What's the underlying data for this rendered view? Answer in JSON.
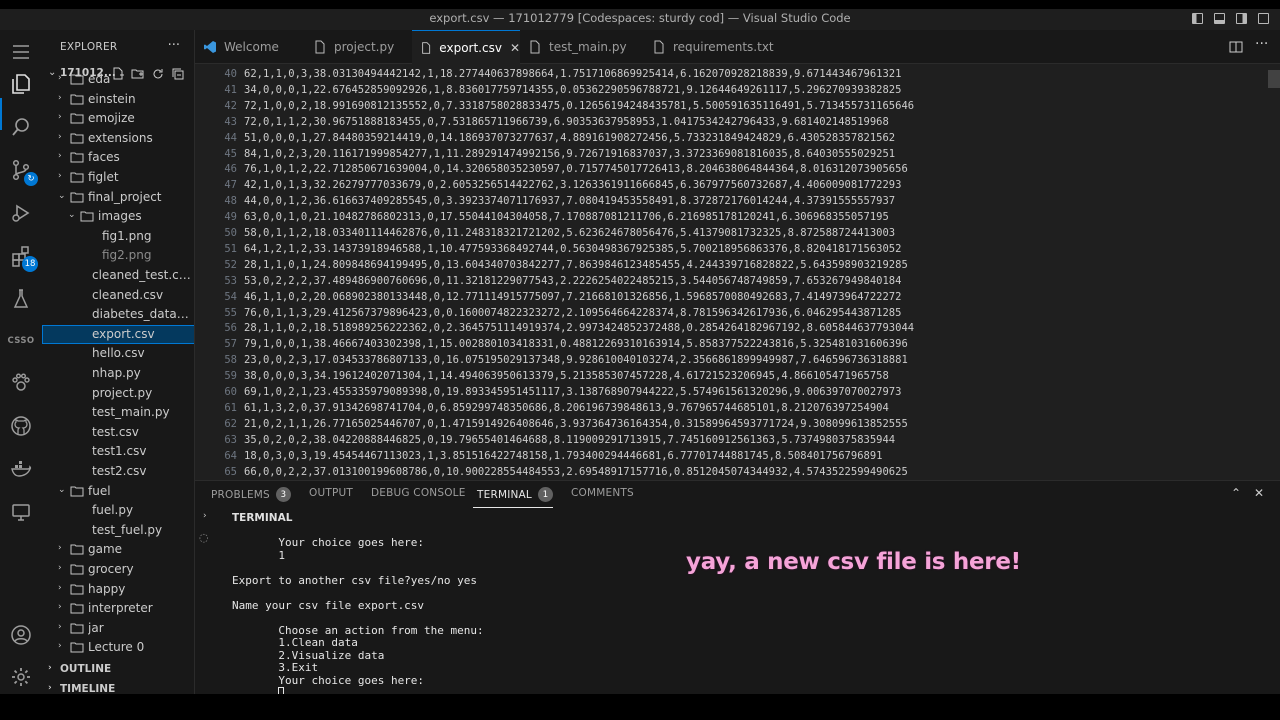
{
  "window": {
    "title": "export.csv — 17101277​9 [Codespaces: sturdy cod] — Visual Studio Code"
  },
  "activity_bar": {
    "extensions_badge": "18",
    "csso_label": "CSSO"
  },
  "sidebar": {
    "header": "EXPLORER",
    "more": "···",
    "root": "171012...",
    "items": [
      {
        "label": "eda",
        "type": "folder",
        "depth": 1,
        "expanded": false
      },
      {
        "label": "einstein",
        "type": "folder",
        "depth": 1,
        "expanded": false
      },
      {
        "label": "emojize",
        "type": "folder",
        "depth": 1,
        "expanded": false
      },
      {
        "label": "extensions",
        "type": "folder",
        "depth": 1,
        "expanded": false
      },
      {
        "label": "faces",
        "type": "folder",
        "depth": 1,
        "expanded": false
      },
      {
        "label": "figlet",
        "type": "folder",
        "depth": 1,
        "expanded": false
      },
      {
        "label": "final_project",
        "type": "folder",
        "depth": 1,
        "expanded": true
      },
      {
        "label": "images",
        "type": "folder",
        "depth": 2,
        "expanded": true
      },
      {
        "label": "fig1.png",
        "type": "file",
        "depth": 3
      },
      {
        "label": "fig2.png",
        "type": "file",
        "depth": 3,
        "dim": true
      },
      {
        "label": "cleaned_test.csv",
        "type": "file",
        "depth": 2
      },
      {
        "label": "cleaned.csv",
        "type": "file",
        "depth": 2
      },
      {
        "label": "diabetes_data....",
        "type": "file",
        "depth": 2
      },
      {
        "label": "export.csv",
        "type": "file",
        "depth": 2,
        "selected": true
      },
      {
        "label": "hello.csv",
        "type": "file",
        "depth": 2
      },
      {
        "label": "nhap.py",
        "type": "file",
        "depth": 2
      },
      {
        "label": "project.py",
        "type": "file",
        "depth": 2
      },
      {
        "label": "test_main.py",
        "type": "file",
        "depth": 2
      },
      {
        "label": "test.csv",
        "type": "file",
        "depth": 2
      },
      {
        "label": "test1.csv",
        "type": "file",
        "depth": 2
      },
      {
        "label": "test2.csv",
        "type": "file",
        "depth": 2
      },
      {
        "label": "fuel",
        "type": "folder",
        "depth": 1,
        "expanded": true
      },
      {
        "label": "fuel.py",
        "type": "file",
        "depth": 2
      },
      {
        "label": "test_fuel.py",
        "type": "file",
        "depth": 2
      },
      {
        "label": "game",
        "type": "folder",
        "depth": 1,
        "expanded": false
      },
      {
        "label": "grocery",
        "type": "folder",
        "depth": 1,
        "expanded": false
      },
      {
        "label": "happy",
        "type": "folder",
        "depth": 1,
        "expanded": false
      },
      {
        "label": "interpreter",
        "type": "folder",
        "depth": 1,
        "expanded": false
      },
      {
        "label": "jar",
        "type": "folder",
        "depth": 1,
        "expanded": false
      },
      {
        "label": "Lecture 0",
        "type": "folder",
        "depth": 1,
        "expanded": false
      }
    ],
    "outline": "OUTLINE",
    "timeline": "TIMELINE"
  },
  "tabs": [
    {
      "label": "Welcome",
      "icon": "vscode-icon"
    },
    {
      "label": "project.py",
      "icon": "file-icon"
    },
    {
      "label": "export.csv",
      "icon": "file-icon",
      "active": true
    },
    {
      "label": "test_main.py",
      "icon": "file-icon"
    },
    {
      "label": "requirements.txt",
      "icon": "file-icon"
    }
  ],
  "editor": {
    "lines": [
      {
        "n": "40",
        "t": "62,1,1,0,3,38.03130494442142,1,18.277440637898664,1.7517106869925414,6.162070928218839,9.671443467961321"
      },
      {
        "n": "41",
        "t": "34,0,0,0,1,22.676452859092926,1,8.836017759714355,0.05362290596788721,9.12644649261117,5.296270939382825"
      },
      {
        "n": "42",
        "t": "72,1,0,0,2,18.991690812135552,0,7.3318758028833475,0.12656194248435781,5.500591635116491,5.713455731165646"
      },
      {
        "n": "43",
        "t": "72,0,1,1,2,30.96751888183455,0,7.531865711966739,6.90353637958953,1.0417534242796433,9.681402148519968"
      },
      {
        "n": "44",
        "t": "51,0,0,0,1,27.84480359214419,0,14.186937073277637,4.889161908272456,5.733231849424829,6.430528357821562"
      },
      {
        "n": "45",
        "t": "84,1,0,2,3,20.116171999854277,1,11.289291474992156,9.72671916837037,3.3723369081816035,8.64030555029251"
      },
      {
        "n": "46",
        "t": "76,1,0,1,2,22.712850671639004,0,14.320658035230597,0.7157745017726413,8.204638064844364,8.016312073905656"
      },
      {
        "n": "47",
        "t": "42,1,0,1,3,32.26279777033679,0,2.6053256514422762,3.1263361911666845,6.367977560732687,4.406009081772293"
      },
      {
        "n": "48",
        "t": "44,0,0,1,2,36.616637409285545,0,3.3923374071176937,7.080419453558491,8.372872176014244,4.37391555557937"
      },
      {
        "n": "49",
        "t": "63,0,0,1,0,21.10482786802313,0,17.55044104304058,7.170887081211706,6.216985178120241,6.306968355057195"
      },
      {
        "n": "50",
        "t": "58,0,1,1,2,18.033401114462876,0,11.248318321721202,5.623624678056476,5.41379081732325,8.872588724413003"
      },
      {
        "n": "51",
        "t": "64,1,2,1,2,33.14373918946588,1,10.477593368492744,0.5630498367925385,5.700218956863376,8.820418171563052"
      },
      {
        "n": "52",
        "t": "28,1,1,0,1,24.809848694199495,0,13.604340703842277,7.8639846123485455,4.244339716828822,5.643598903219285"
      },
      {
        "n": "53",
        "t": "53,0,2,2,2,37.489486900760696,0,11.32181229077543,2.2226254022485215,3.544056748749859,7.653267949840184"
      },
      {
        "n": "54",
        "t": "46,1,1,0,2,20.068902380133448,0,12.771114915775097,7.21668101326856,1.5968570080492683,7.414973964722272"
      },
      {
        "n": "55",
        "t": "76,0,1,1,3,29.412567379896423,0,0.1600074822323272,2.109564664228374,8.781596342617936,6.046295443871285"
      },
      {
        "n": "56",
        "t": "28,1,1,0,2,18.518989256222362,0,2.3645751114919374,2.9973424852372488,0.2854264182967192,8.605844637793044"
      },
      {
        "n": "57",
        "t": "79,1,0,0,1,38.46667403302398,1,15.002880103418331,0.48812269310163914,5.858377522243816,5.325481031606396"
      },
      {
        "n": "58",
        "t": "23,0,0,2,3,17.034533786807133,0,16.075195029137348,9.928610040103274,2.3566861899949987,7.646596736318881"
      },
      {
        "n": "59",
        "t": "38,0,0,0,3,34.19612402071304,1,14.494063950613379,5.213585307457228,4.61721523206945,4.866105471965758"
      },
      {
        "n": "60",
        "t": "69,1,0,2,1,23.455335979089398,0,19.893345951451117,3.138768907944222,5.574961561320296,9.006397070027973"
      },
      {
        "n": "61",
        "t": "61,1,3,2,0,37.91342698741704,0,6.859299748350686,8.206196739848613,9.767965744685101,8.212076397254904"
      },
      {
        "n": "62",
        "t": "21,0,2,1,1,26.77165025446707,0,1.4715914926408646,3.937364736164354,0.31589964593771724,9.308099613852555"
      },
      {
        "n": "63",
        "t": "35,0,2,0,2,38.04220888446825,0,19.79655401464688,8.119009291713915,7.745160912561363,5.7374980375835944"
      },
      {
        "n": "64",
        "t": "18,0,3,0,3,19.45454467113023,1,3.851516422748158,1.793400294446681,6.77701744881745,8.508401756796891"
      },
      {
        "n": "65",
        "t": "66,0,0,2,2,37.013100199608786,0,10.900228554484553,2.69548917157716,0.8512045074344932,4.5743522599490625"
      }
    ]
  },
  "panel": {
    "tabs": [
      {
        "label": "PROBLEMS",
        "count": "3"
      },
      {
        "label": "OUTPUT"
      },
      {
        "label": "DEBUG CONSOLE"
      },
      {
        "label": "TERMINAL",
        "count": "1",
        "active": true
      },
      {
        "label": "COMMENTS"
      }
    ],
    "terminal_header": "TERMINAL",
    "terminal_lines": [
      "       Your choice goes here:",
      "       1",
      "",
      "Export to another csv file?yes/no yes",
      "",
      "Name your csv file export.csv",
      "",
      "       Choose an action from the menu:",
      "       1.Clean data",
      "       2.Visualize data",
      "       3.Exit",
      "       Your choice goes here:"
    ]
  },
  "overlay_caption": "yay, a new csv file is here!"
}
